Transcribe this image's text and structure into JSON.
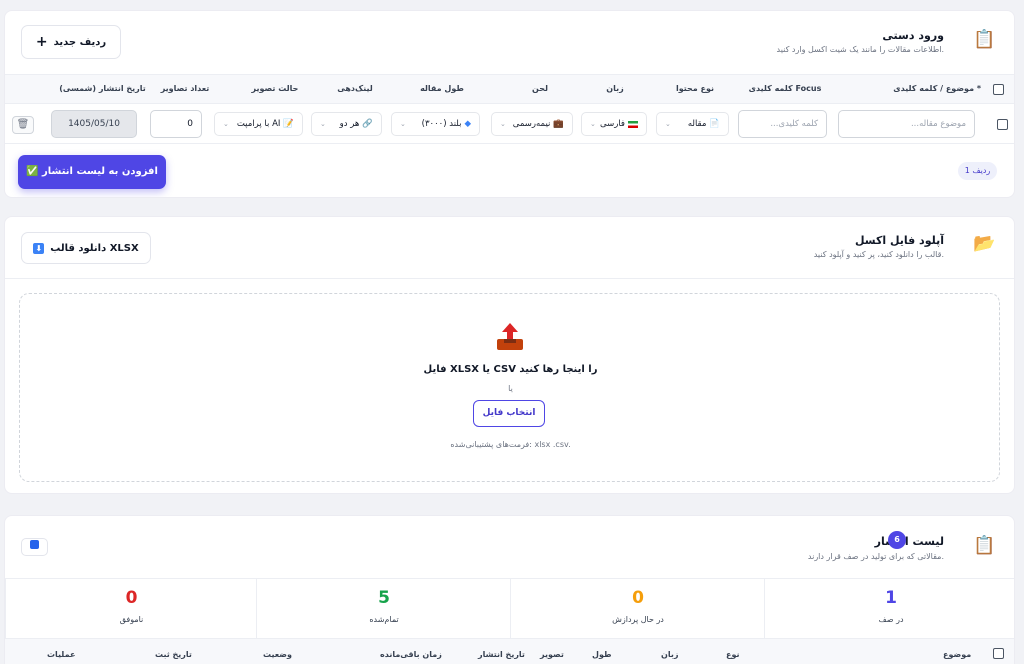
{
  "manual": {
    "title": "ورود دستی",
    "subtitle": "اطلاعات مقالات را مانند یک شیت اکسل وارد کنید.",
    "title_icon": "clipboard-icon",
    "new_row_label": "ردیف جدید",
    "columns": {
      "topic": "موضوع / کلمه کلیدی *",
      "focus": "کلمه کلیدی Focus",
      "content_type": "نوع محتوا",
      "language": "زبان",
      "tone": "لحن",
      "length": "طول مقاله",
      "linking": "لینک‌دهی",
      "image_mode": "حالت تصویر",
      "image_count": "تعداد تصاویر",
      "publish_date": "تاریخ انتشار (شمسی)"
    },
    "row": {
      "topic_placeholder": "موضوع مقاله...",
      "focus_placeholder": "کلمه کلیدی...",
      "content_type": "مقاله",
      "language": "فارسی",
      "tone": "نیمه‌رسمی",
      "length": "بلند (۳۰۰۰)",
      "linking": "هر دو",
      "image_mode": "AI با پرامپت",
      "image_count": "0",
      "publish_date": "1405/05/10"
    },
    "row_count": "1 ردیف",
    "add_button": "✅ افزودن به لیست انتشار",
    "accent": "#4f46e5"
  },
  "upload": {
    "title": "آپلود فایل اکسل",
    "subtitle": "قالب را دانلود کنید، پر کنید و آپلود کنید.",
    "download_label": "دانلود قالب XLSX",
    "drop_title": "فایل XLSX یا CSV را اینجا رها کنید",
    "or": "یا",
    "choose_file": "انتخاب فایل",
    "formats": "فرمت‌های پشتیبانی‌شده: xlsx .csv."
  },
  "queue": {
    "title": "لیست انتشار",
    "badge": "6",
    "subtitle": "مقالاتی که برای تولید در صف قرار دارند.",
    "stats": [
      {
        "value": "1",
        "label": "در صف",
        "color": "#4f46e5"
      },
      {
        "value": "0",
        "label": "در حال پردازش",
        "color": "#f59e0b"
      },
      {
        "value": "5",
        "label": "تمام‌شده",
        "color": "#16a34a"
      },
      {
        "value": "0",
        "label": "ناموفق",
        "color": "#dc2626"
      }
    ],
    "columns": {
      "topic": "موضوع",
      "type": "نوع",
      "language": "زبان",
      "length": "طول",
      "image": "تصویر",
      "publish_date": "تاریخ انتشار",
      "remaining": "زمان باقی‌مانده",
      "status": "وضعیت",
      "created": "تاریخ ثبت",
      "actions": "عملیات"
    }
  }
}
